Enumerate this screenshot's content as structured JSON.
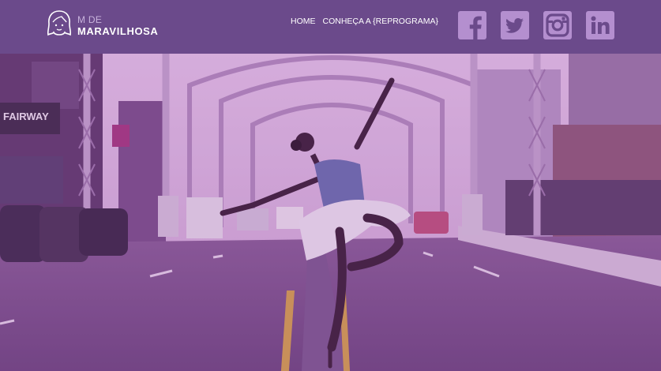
{
  "brand": {
    "line1": "M DE",
    "line2": "MARAVILHOSA",
    "logo_icon": "woman-face-icon"
  },
  "nav": [
    {
      "label": "HOME"
    },
    {
      "label": "CONHEÇA A {REPROGRAMA}"
    }
  ],
  "social": [
    {
      "name": "facebook",
      "icon": "facebook-icon"
    },
    {
      "name": "twitter",
      "icon": "twitter-icon"
    },
    {
      "name": "instagram",
      "icon": "instagram-icon"
    },
    {
      "name": "linkedin",
      "icon": "linkedin-icon"
    }
  ],
  "hero": {
    "image": "ballet-dancer-on-bridge-road",
    "signs": {
      "fairway": "FAIRWAY"
    }
  },
  "colors": {
    "header": "#6b4a8b",
    "icon": "#b48fcf",
    "overlay": "#8a3f9a"
  }
}
